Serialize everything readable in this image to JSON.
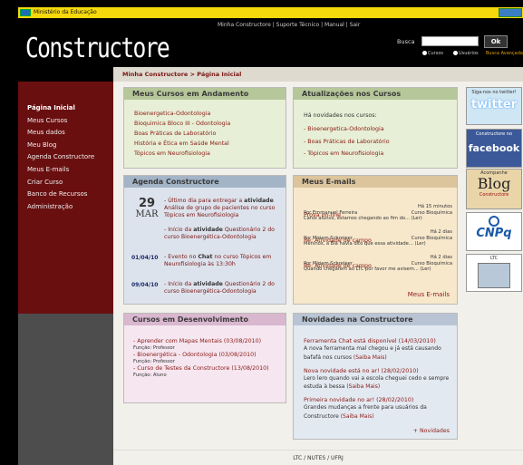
{
  "gov": {
    "label": "Ministério da Educação"
  },
  "header": {
    "links": "Minha Constructore | Suporte Técnico | Manual | Sair",
    "logo": "Constructore",
    "search_label": "Busca",
    "search_button": "Ok",
    "radio_cursos": "Cursos",
    "radio_usuarios": "Usuários",
    "advanced": "Busca Avançada"
  },
  "breadcrumb": "Minha Constructore  >  Página Inicial",
  "sidebar": {
    "items": [
      {
        "label": "Página Inicial",
        "active": true
      },
      {
        "label": "Meus Cursos"
      },
      {
        "label": "Meus dados"
      },
      {
        "label": "Meu Blog"
      },
      {
        "label": "Agenda Constructore"
      },
      {
        "label": "Meus E-mails"
      },
      {
        "label": "Criar Curso"
      },
      {
        "label": "Banco de Recursos"
      },
      {
        "label": "Administração"
      }
    ]
  },
  "cursos": {
    "title": "Meus Cursos em Andamento",
    "items": [
      "Bioenergetica-Odontologia",
      "Bioquimica Bloco III - Odontologia",
      "Boas Práticas de Laboratório",
      "História e Ética em Saúde Mental",
      "Tópicos em Neurofisiologia"
    ]
  },
  "atualizacoes": {
    "title": "Atualizações nos Cursos",
    "intro": "Há novidades nos cursos:",
    "items": [
      "- Bioenergetica-Odontologia",
      "- Boas Práticas de Laboratório",
      "- Tópicos em Neurofisiologia"
    ]
  },
  "agenda": {
    "title": "Agenda Constructore",
    "day": "29",
    "month": "MAR",
    "e1": {
      "pre": "- Último dia para entregar a ",
      "bold": "atividade",
      "post": " Análise de grupo de pacientes no curso Tópicos em Neurofisiologia"
    },
    "e2": {
      "pre": "- Início da ",
      "bold": "atividade",
      "post": " Questionário 2 do curso Bioenergética-Odontologia"
    },
    "e3": {
      "date": "01/04/10",
      "pre": "- Evento no ",
      "bold": "Chat",
      "post": " no curso Tópicos em Neurofisiologia às 13:30h"
    },
    "e4": {
      "date": "09/04/10",
      "pre": "- Início da ",
      "bold": "atividade",
      "post": " Questionário 2 do curso Bioenergética-Odontologia"
    }
  },
  "emails": {
    "title": "Meus E-mails",
    "items": [
      {
        "subject": "Prova on-line",
        "time": "Há 15 minutos",
        "from": "Por Emmanuel Ferreira",
        "course": "Curso Bioquímica",
        "preview": "Caros alunos, estamos chegando ao fim do... (Ler)"
      },
      {
        "subject": "Re: Atividade de campo",
        "time": "Há 2 dias",
        "from": "Por Miriam Schreiner",
        "course": "Curso Bioquímica",
        "preview": "Meninos, a Bia havia dito que essa atividade... (Ler)"
      },
      {
        "subject": "Re: Atividade de campo",
        "time": "Há 2 dias",
        "from": "Por Miriam Schreiner",
        "course": "Curso Bioquímica",
        "preview": "Quando chegarem ao LTC por favor me avisem... (Ler)"
      }
    ],
    "more": "Meus E-mails"
  },
  "desenv": {
    "title": "Cursos em Desenvolvimento",
    "items": [
      {
        "name": "- Aprender com Mapas Mentais (03/08/2010)",
        "role": "Função: Professor"
      },
      {
        "name": "- Bioenergética - Odontologia (03/08/2010)",
        "role": "Função: Professor"
      },
      {
        "name": "- Curso de Testes da Constructore (13/08/2010)",
        "role": "Função: Aluno"
      }
    ]
  },
  "novidades": {
    "title": "Novidades na Constructore",
    "items": [
      {
        "head": "Ferramenta Chat está disponível (14/03/2010)",
        "body": "A nova ferramenta mal chegou e já está causando bafafá nos cursos",
        "more": "(Saiba Mais)"
      },
      {
        "head": "Nova novidade está no ar! (28/02/2010)",
        "body": "Lero lero  quando vai a escola cheguei cedo e sempre estuda à bessa",
        "more": "(Saiba Mais)"
      },
      {
        "head": "Primeira novidade no ar! (28/02/2010)",
        "body": "Grandes mudanças a frente para usuários da Constructore",
        "more": "(Saiba Mais)"
      }
    ],
    "more": "+ Novidades"
  },
  "right": {
    "twitter_top": "Siga-nos no twitter!",
    "twitter": "twitter",
    "facebook_top": "Constructore no",
    "facebook": "facebook",
    "blog_top": "Acompanhe",
    "blog": "Blog",
    "blog_sub": "Constructore",
    "cnpq": "CNPq",
    "ltc": "LTC"
  },
  "footer": "LTC / NUTES / UFRJ",
  "colors": {
    "sidebar": "#6a0f10",
    "accent": "#8b1a14",
    "gov": "#f5d90c"
  }
}
